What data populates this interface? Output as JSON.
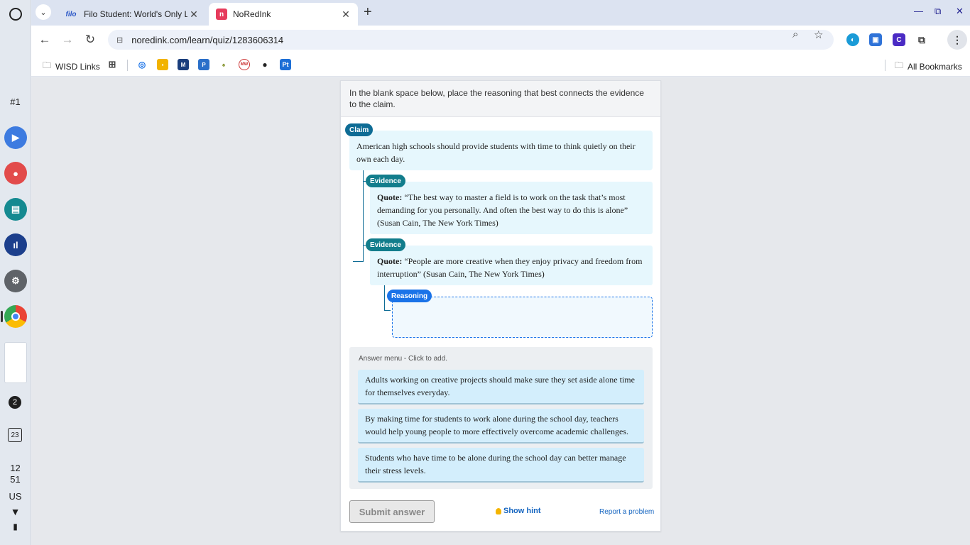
{
  "browser": {
    "tabs": [
      {
        "title": "Filo Student: World's Only Live I",
        "favicon": "filo"
      },
      {
        "title": "NoRedInk",
        "favicon": "N"
      }
    ],
    "url": "noredink.com/learn/quiz/1283606314",
    "bookmarks": {
      "folder": "WISD Links",
      "all": "All Bookmarks",
      "icon_text": [
        "MW",
        "Pt"
      ]
    }
  },
  "shelf": {
    "notification_count": "#1",
    "badge": "2",
    "calendar": "23",
    "time_hour": "12",
    "time_min": "51",
    "locale": "US"
  },
  "quiz": {
    "instructions": "In the blank space below, place the reasoning that best connects the evidence to the claim.",
    "claim_tag": "Claim",
    "claim_text": "American high schools should provide students with time to think quietly on their own each day.",
    "evidence_tag": "Evidence",
    "quote_label": "Quote:",
    "evidence_1": "“The best way to master a field is to work on the task that’s most demanding for you personally. And often the best way to do this is alone” (Susan Cain, The New York Times)",
    "evidence_2": "“People are more creative when they enjoy privacy and freedom from interruption” (Susan Cain, The New York Times)",
    "reasoning_tag": "Reasoning",
    "answer_menu_label": "Answer menu - Click to add.",
    "options": [
      "Adults working on creative projects should make sure they set aside alone time for themselves everyday.",
      "By making time for students to work alone during the school day, teachers would help young people to more effectively overcome academic challenges.",
      "Students who have time to be alone during the school day can better manage their stress levels."
    ],
    "submit_label": "Submit answer",
    "hint_label": "Show hint",
    "report_label": "Report a problem"
  }
}
